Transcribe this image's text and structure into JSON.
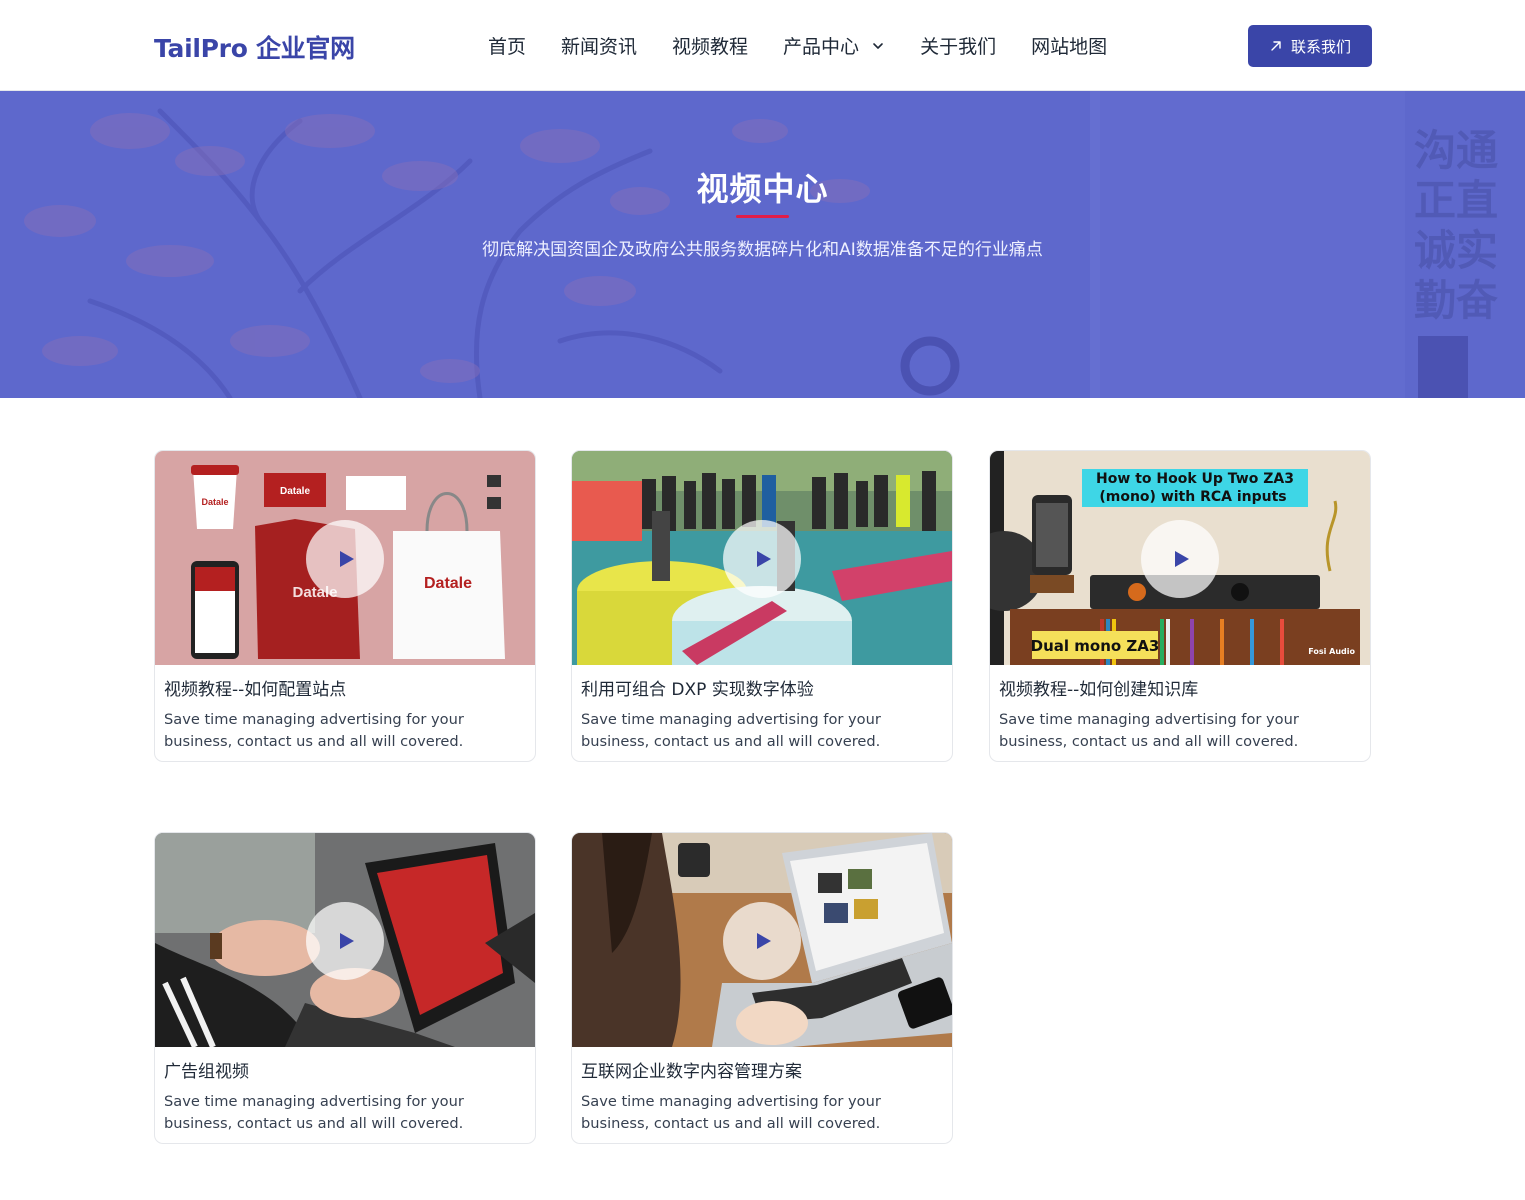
{
  "header": {
    "logo": "TailPro 企业官网",
    "nav": [
      {
        "label": "首页"
      },
      {
        "label": "新闻资讯"
      },
      {
        "label": "视频教程"
      },
      {
        "label": "产品中心",
        "dropdown": true
      },
      {
        "label": "关于我们"
      },
      {
        "label": "网站地图"
      }
    ],
    "contact_label": "联系我们",
    "accent_color": "#3a45a8"
  },
  "hero": {
    "title": "视频中心",
    "subtitle": "彻底解决国资国企及政府公共服务数据碎片化和AI数据准备不足的行业痛点",
    "overlay_color": "#5d67cb",
    "bg_text": [
      "沟通",
      "正直",
      "诚实",
      "勤奋"
    ]
  },
  "cards": [
    {
      "title": "视频教程--如何配置站点",
      "desc": "Save time managing advertising for your business, contact us and all will covered.",
      "thumb_texts": [
        "Datale"
      ]
    },
    {
      "title": "利用可组合 DXP 实现数字体验",
      "desc": "Save time managing advertising for your business, contact us and all will covered."
    },
    {
      "title": "视频教程--如何创建知识库",
      "desc": "Save time managing advertising for your business, contact us and all will covered.",
      "thumb_texts": [
        "How to Hook Up Two ZA3",
        "(mono) with RCA inputs",
        "Dual mono ZA3",
        "Fosi Audio"
      ]
    },
    {
      "title": "广告组视频",
      "desc": "Save time managing advertising for your business, contact us and all will covered."
    },
    {
      "title": "互联网企业数字内容管理方案",
      "desc": "Save time managing advertising for your business, contact us and all will covered."
    }
  ]
}
